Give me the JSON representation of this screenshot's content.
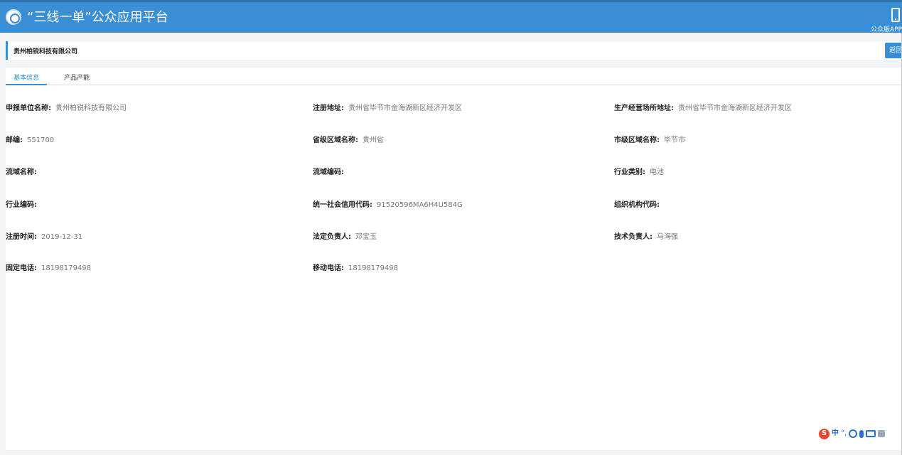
{
  "header": {
    "title": "“三线一单”公众应用平台",
    "app_label": "公众版APP"
  },
  "company_bar": {
    "name": "贵州柏锐科技有限公司",
    "back_label": "返回"
  },
  "tabs": [
    {
      "label": "基本信息",
      "active": true
    },
    {
      "label": "产品产能",
      "active": false
    }
  ],
  "fields": {
    "applicant_name": {
      "label": "申报单位名称:",
      "value": "贵州柏锐科技有限公司"
    },
    "registered_address": {
      "label": "注册地址:",
      "value": "贵州省毕节市金海湖新区经济开发区"
    },
    "operating_address": {
      "label": "生产经营场所地址:",
      "value": "贵州省毕节市金海湖新区经济开发区"
    },
    "postcode": {
      "label": "邮编:",
      "value": "551700"
    },
    "province": {
      "label": "省级区域名称:",
      "value": "贵州省"
    },
    "city": {
      "label": "市级区域名称:",
      "value": "毕节市"
    },
    "basin_name": {
      "label": "流域名称:",
      "value": ""
    },
    "basin_code": {
      "label": "流域编码:",
      "value": ""
    },
    "industry_type": {
      "label": "行业类别:",
      "value": "电池"
    },
    "industry_code": {
      "label": "行业编码:",
      "value": ""
    },
    "credit_code": {
      "label": "统一社会信用代码:",
      "value": "91520596MA6H4U584G"
    },
    "org_code": {
      "label": "组织机构代码:",
      "value": ""
    },
    "register_date": {
      "label": "注册时间:",
      "value": "2019-12-31"
    },
    "legal_person": {
      "label": "法定负责人:",
      "value": "邓宝玉"
    },
    "tech_person": {
      "label": "技术负责人:",
      "value": "马海强"
    },
    "landline": {
      "label": "固定电话:",
      "value": "18198179498"
    },
    "mobile": {
      "label": "移动电话:",
      "value": "18198179498"
    }
  },
  "ime": {
    "logo": "S",
    "lang": "中",
    "punc": "°,"
  },
  "colors": {
    "header_bg": "#3a8fd4",
    "accent": "#3a8fd4",
    "label_text": "#222222",
    "value_text": "#777777"
  }
}
